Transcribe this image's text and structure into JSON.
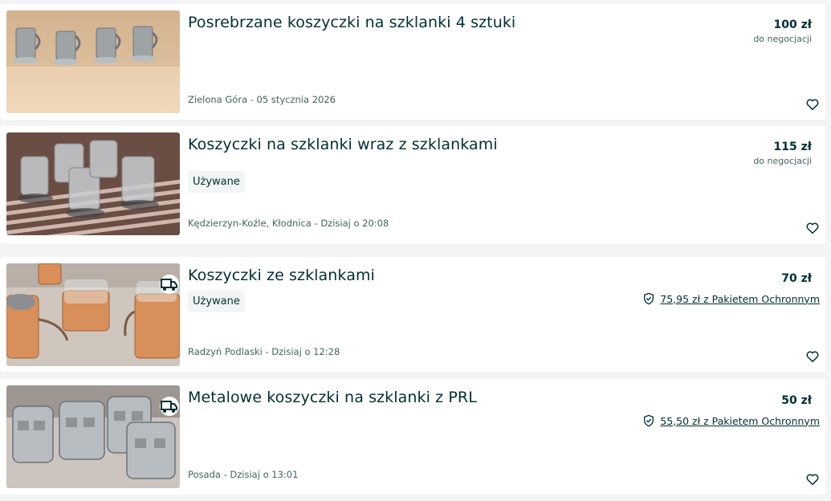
{
  "listings": [
    {
      "title": "Posrebrzane koszyczki na szklanki 4 sztuki",
      "condition": "",
      "location_date": "Zielona Góra - 05 stycznia 2026",
      "price": "100 zł",
      "negotiable": "do negocjacji",
      "protection": "",
      "has_delivery": false
    },
    {
      "title": "Koszyczki na szklanki wraz z szklankami",
      "condition": "Używane",
      "location_date": "Kędzierzyn-Koźle, Kłodnica - Dzisiaj o 20:08",
      "price": "115 zł",
      "negotiable": "do negocjacji",
      "protection": "",
      "has_delivery": false
    },
    {
      "title": "Koszyczki ze szklankami",
      "condition": "Używane",
      "location_date": "Radzyń Podlaski - Dzisiaj o 12:28",
      "price": "70 zł",
      "negotiable": "",
      "protection": "75,95 zł z Pakietem Ochronnym",
      "has_delivery": true
    },
    {
      "title": "Metalowe koszyczki na szklanki z PRL",
      "condition": "",
      "location_date": "Posada - Dzisiaj o 13:01",
      "price": "50 zł",
      "negotiable": "",
      "protection": "55,50 zł z Pakietem Ochronnym",
      "has_delivery": true
    }
  ],
  "icons": {
    "favorite": "heart-icon",
    "delivery": "truck-icon",
    "protection": "shield-check-icon"
  },
  "colors": {
    "background": "#f2f4f5",
    "card": "#ffffff",
    "text": "#002f34",
    "muted": "#406367"
  }
}
